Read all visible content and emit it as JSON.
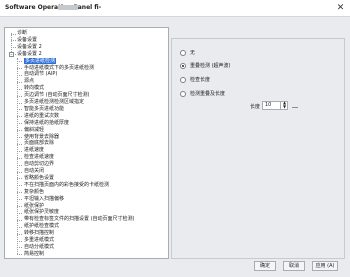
{
  "window": {
    "title": "Software Operation Panel fi-",
    "close_glyph": "✕"
  },
  "tree": {
    "items": [
      {
        "label": "诊断",
        "level": 1,
        "expander": ""
      },
      {
        "label": "设备设置",
        "level": 1,
        "expander": ""
      },
      {
        "label": "设备设置 2",
        "level": 1,
        "expander": ""
      },
      {
        "label": "设备设置 2",
        "level": 1,
        "expander": "-"
      },
      {
        "label": "多页进纸检测",
        "level": 2,
        "expander": "",
        "selected": true
      },
      {
        "label": "手动进纸模式下的多页进纸检测",
        "level": 2
      },
      {
        "label": "自动调节 (AIP)",
        "level": 2
      },
      {
        "label": "源点",
        "level": 2
      },
      {
        "label": "转向模式",
        "level": 2
      },
      {
        "label": "页边调节 (自动页面尺寸检测)",
        "level": 2
      },
      {
        "label": "多页进纸检测检测区域指定",
        "level": 2
      },
      {
        "label": "智能多页进纸功能",
        "level": 2
      },
      {
        "label": "进纸的重试次数",
        "level": 2
      },
      {
        "label": "保持进纸的拾纸厚度",
        "level": 2
      },
      {
        "label": "偏斜减轻",
        "level": 2
      },
      {
        "label": "使用背景去除器",
        "level": 2
      },
      {
        "label": "页面底部去除",
        "level": 2
      },
      {
        "label": "进纸速度",
        "level": 2
      },
      {
        "label": "检查进纸速度",
        "level": 2
      },
      {
        "label": "自动剪切边界",
        "level": 2
      },
      {
        "label": "自动关闭",
        "level": 2
      },
      {
        "label": "省略颜色设置",
        "level": 2
      },
      {
        "label": "不在扫描页面内的彩色接受的卡纸检测",
        "level": 2
      },
      {
        "label": "复杂颜色",
        "level": 2
      },
      {
        "label": "平坦输入扫描偏移",
        "level": 2
      },
      {
        "label": "纸张保护",
        "level": 2
      },
      {
        "label": "纸张保护灵敏度",
        "level": 2
      },
      {
        "label": "带有检查标签文件的扫描设置 (自动页面尺寸检测)",
        "level": 2
      },
      {
        "label": "纸护纸检查模式",
        "level": 2
      },
      {
        "label": "转移扫描控制",
        "level": 2
      },
      {
        "label": "多重进纸模式",
        "level": 2
      },
      {
        "label": "自动分纸模式",
        "level": 2
      },
      {
        "label": "简易控制",
        "level": 2
      }
    ]
  },
  "settings": {
    "options": [
      {
        "label": "无",
        "checked": false
      },
      {
        "label": "重叠检测 (超声波)",
        "checked": true
      },
      {
        "label": "检查长度",
        "checked": false
      },
      {
        "label": "检测重叠及长度",
        "checked": false
      }
    ],
    "length_label": "长度",
    "length_value": "10"
  },
  "footer": {
    "ok_label": "确定",
    "cancel_label": "取消",
    "apply_label": "应用 (A)"
  }
}
